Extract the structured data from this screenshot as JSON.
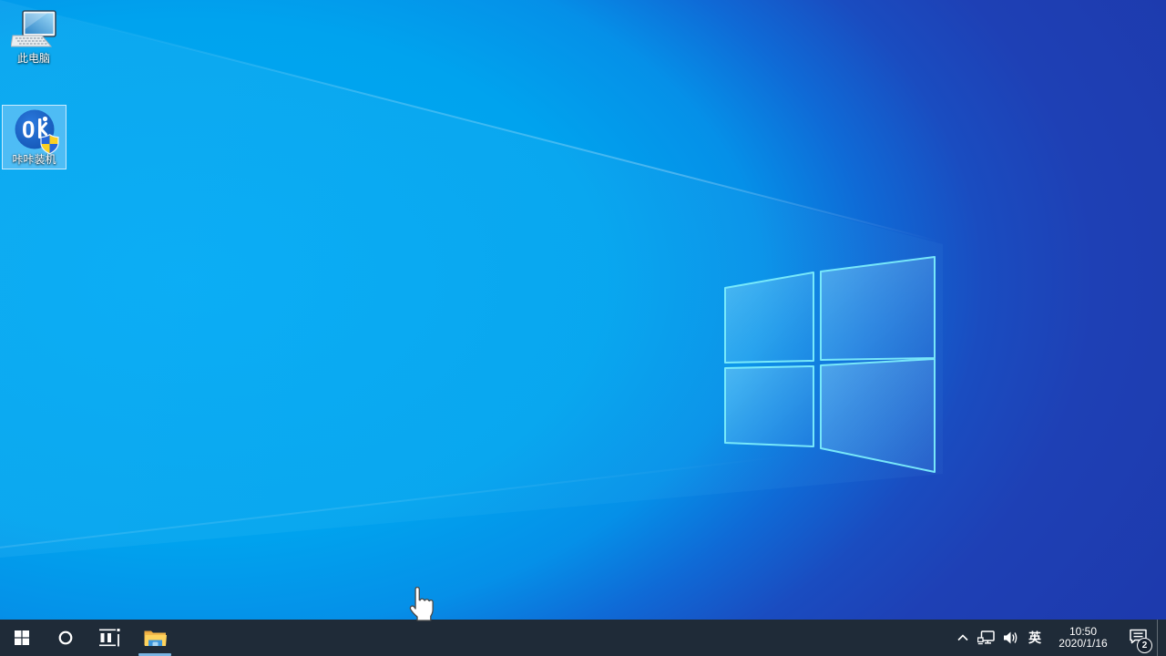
{
  "wallpaper": {
    "base_bright": "#00a6f0",
    "base_deep": "#1d3fb3",
    "logo_border": "#7deefc"
  },
  "desktop": {
    "icons": [
      {
        "label": "此电脑",
        "icon": "this-pc-icon",
        "selected": false
      },
      {
        "label": "咔咔装机",
        "icon": "kaka-installer-icon",
        "selected": true,
        "has_uac_shield": true
      }
    ]
  },
  "taskbar": {
    "color": "#1f2b38",
    "active_underline": "#7ab4e2",
    "buttons": [
      {
        "name": "start",
        "icon": "windows-logo-icon"
      },
      {
        "name": "search",
        "icon": "search-circle-icon"
      },
      {
        "name": "task-view",
        "icon": "task-view-icon"
      },
      {
        "name": "file-explorer",
        "icon": "folder-icon",
        "running": true
      }
    ],
    "tray": {
      "chevron": "show-hidden-icons",
      "network": "ethernet-icon",
      "volume": "speaker-icon",
      "ime_label": "英",
      "time": "10:50",
      "date": "2020/1/16",
      "notification_badge": "2"
    }
  },
  "cursor": {
    "type": "hand-pointer"
  }
}
